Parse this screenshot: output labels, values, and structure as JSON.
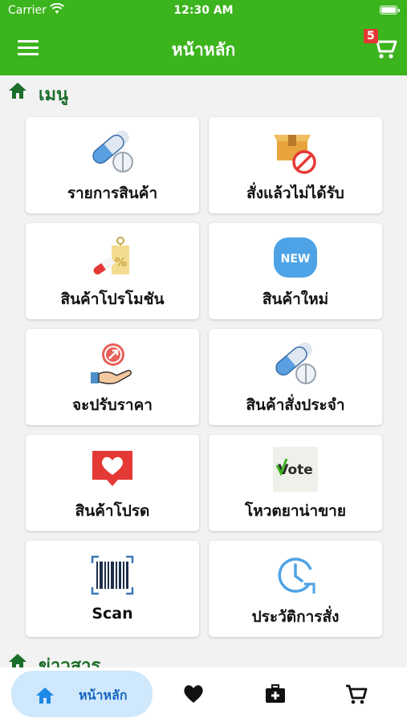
{
  "status_bar": {
    "carrier": "Carrier",
    "time": "12:30 AM"
  },
  "navbar": {
    "title": "หน้าหลัก",
    "cart_badge": "5"
  },
  "sections": {
    "menu_title": "เมนู",
    "news_title": "ข่าวสาร"
  },
  "menu_items": [
    {
      "label": "รายการสินค้า",
      "icon": "capsule-pill-icon"
    },
    {
      "label": "สั่งแล้วไม่ได้รับ",
      "icon": "box-cancel-icon"
    },
    {
      "label": "สินค้าโปรโมชัน",
      "icon": "promotion-tag-icon"
    },
    {
      "label": "สินค้าใหม่",
      "icon": "new-badge-icon",
      "badge_text": "NEW"
    },
    {
      "label": "จะปรับราคา",
      "icon": "price-adjust-hand-icon"
    },
    {
      "label": "สินค้าสั่งประจำ",
      "icon": "capsule-pill-icon"
    },
    {
      "label": "สินค้าโปรด",
      "icon": "heart-message-icon"
    },
    {
      "label": "โหวตยาน่าขาย",
      "icon": "vote-icon",
      "badge_text": "Vote"
    },
    {
      "label": "Scan",
      "icon": "barcode-scan-icon"
    },
    {
      "label": "ประวัติการสั่ง",
      "icon": "history-clock-icon"
    }
  ],
  "tab_bar": {
    "active_label": "หน้าหลัก"
  },
  "colors": {
    "primary": "#3cb41e",
    "section_title": "#1b6e2a",
    "tab_active_bg": "#cfe8fb",
    "badge": "#e53935"
  }
}
